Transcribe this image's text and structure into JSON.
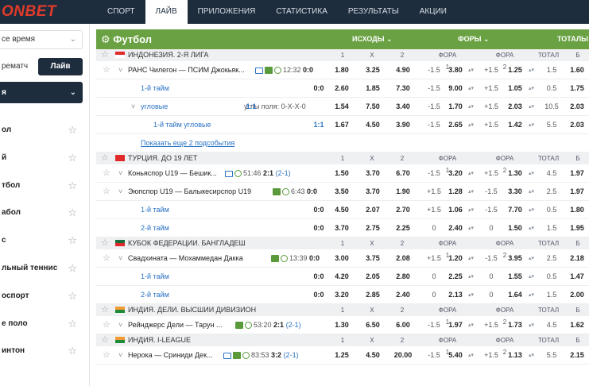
{
  "brand": {
    "logo": "ONBET"
  },
  "nav": [
    "СПОРТ",
    "ЛАЙВ",
    "ПРИЛОЖЕНИЯ",
    "СТАТИСТИКА",
    "РЕЗУЛЬТАТЫ",
    "АКЦИИ"
  ],
  "sidebar": {
    "time_filter": "се время",
    "prematch_label": "рематч",
    "live_label": "Лайв",
    "sport_select": "я",
    "sports": [
      "ол",
      "й",
      "тбол",
      "абол",
      "с",
      "льный теннис",
      "оспорт",
      "е поло",
      "интон"
    ]
  },
  "header": {
    "title": "Футбол",
    "cols": {
      "outcomes": "ИСХОДЫ",
      "handicaps": "ФОРЫ",
      "totals": "ТОТАЛЫ"
    }
  },
  "colheads": {
    "c1": "1",
    "cx": "X",
    "c2": "2",
    "f1": "ФОРА 1",
    "f2": "ФОРА 2",
    "tot": "ТОТАЛ",
    "b": "Б"
  },
  "leagues": [
    {
      "name": "ИНДОНЕЗИЯ. 2-Я ЛИГА"
    },
    {
      "name": "ТУРЦИЯ. ДО 19 ЛЕТ"
    },
    {
      "name": "КУБОК ФЕДЕРАЦИИ. БАНГЛАДЕШ"
    },
    {
      "name": "ИНДИЯ. ДЕЛИ. ВЫСШИИ ДИВИЗИОН"
    },
    {
      "name": "ИНДИЯ. I-LEAGUE"
    }
  ],
  "rows": {
    "r1": {
      "name": "РАНС Чилегон — ПСИМ Джокьяк...",
      "time": "12:32",
      "score": "0:0",
      "o1": "1.80",
      "ox": "3.25",
      "o2": "4.90",
      "h1": "-1.5",
      "f1": "3.80",
      "h2": "+1.5",
      "f2": "1.25",
      "t": "1.5",
      "b": "1.60"
    },
    "r2": {
      "name": "1-й тайм",
      "score": "0:0",
      "o1": "2.60",
      "ox": "1.85",
      "o2": "7.30",
      "h1": "-1.5",
      "f1": "9.00",
      "h2": "+1.5",
      "f2": "1.05",
      "t": "0.5",
      "b": "1.75"
    },
    "r3": {
      "name": "угловые",
      "score": "1:1",
      "extra": "углы поля: 0-Х-Х-0",
      "o1": "1.54",
      "ox": "7.50",
      "o2": "3.40",
      "h1": "-1.5",
      "f1": "1.70",
      "h2": "+1.5",
      "f2": "2.03",
      "t": "10.5",
      "b": "2.03"
    },
    "r4": {
      "name": "1-й тайм угловые",
      "score": "1:1",
      "o1": "1.67",
      "ox": "4.50",
      "o2": "3.90",
      "h1": "-1.5",
      "f1": "2.65",
      "h2": "+1.5",
      "f2": "1.42",
      "t": "5.5",
      "b": "2.03"
    },
    "r5": {
      "more": "Показать еще 2 подсобытия"
    },
    "r6": {
      "name": "Коньяспор U19 — Бешик...",
      "time": "51:46",
      "score": "2:1",
      "sub": "(2-1)",
      "o1": "1.50",
      "ox": "3.70",
      "o2": "6.70",
      "h1": "-1.5",
      "f1": "3.20",
      "h2": "+1.5",
      "f2": "1.30",
      "t": "4.5",
      "b": "1.97"
    },
    "r7": {
      "name": "Эюпспор U19 — Балыкесирспор U19",
      "time": "6:43",
      "score": "0:0",
      "o1": "3.50",
      "ox": "3.70",
      "o2": "1.90",
      "h1": "+1.5",
      "f1": "1.28",
      "h2": "-1.5",
      "f2": "3.30",
      "t": "2.5",
      "b": "1.97"
    },
    "r8": {
      "name": "1-й тайм",
      "score": "0:0",
      "o1": "4.50",
      "ox": "2.07",
      "o2": "2.70",
      "h1": "+1.5",
      "f1": "1.06",
      "h2": "-1.5",
      "f2": "7.70",
      "t": "0.5",
      "b": "1.80"
    },
    "r9": {
      "name": "2-й тайм",
      "score": "0:0",
      "o1": "3.70",
      "ox": "2.75",
      "o2": "2.25",
      "h1": "0",
      "f1": "2.40",
      "h2": "0",
      "f2": "1.50",
      "t": "1.5",
      "b": "1.95"
    },
    "r10": {
      "name": "Свадхината — Мохаммедан Дакка",
      "time": "13:39",
      "score": "0:0",
      "o1": "3.00",
      "ox": "3.75",
      "o2": "2.08",
      "h1": "+1.5",
      "f1": "1.20",
      "h2": "-1.5",
      "f2": "3.95",
      "t": "2.5",
      "b": "2.18"
    },
    "r11": {
      "name": "1-й тайм",
      "score": "0:0",
      "o1": "4.20",
      "ox": "2.05",
      "o2": "2.80",
      "h1": "0",
      "f1": "2.25",
      "h2": "0",
      "f2": "1.55",
      "t": "0.5",
      "b": "1.47"
    },
    "r12": {
      "name": "2-й тайм",
      "score": "0:0",
      "o1": "3.20",
      "ox": "2.85",
      "o2": "2.40",
      "h1": "0",
      "f1": "2.13",
      "h2": "0",
      "f2": "1.64",
      "t": "1.5",
      "b": "2.00"
    },
    "r13": {
      "name": "Рейнджерс Дели — Тарун ...",
      "time": "53:20",
      "score": "2:1",
      "sub": "(2-1)",
      "o1": "1.30",
      "ox": "6.50",
      "o2": "6.00",
      "h1": "-1.5",
      "f1": "1.97",
      "h2": "+1.5",
      "f2": "1.73",
      "t": "4.5",
      "b": "1.62"
    },
    "r14": {
      "name": "Нерока — Сриниди Дек...",
      "time": "83:53",
      "score": "3:2",
      "sub": "(2-1)",
      "o1": "1.25",
      "ox": "4.50",
      "o2": "20.00",
      "h1": "-1.5",
      "f1": "5.40",
      "h2": "+1.5",
      "f2": "1.13",
      "t": "5.5",
      "b": "2.15"
    }
  }
}
